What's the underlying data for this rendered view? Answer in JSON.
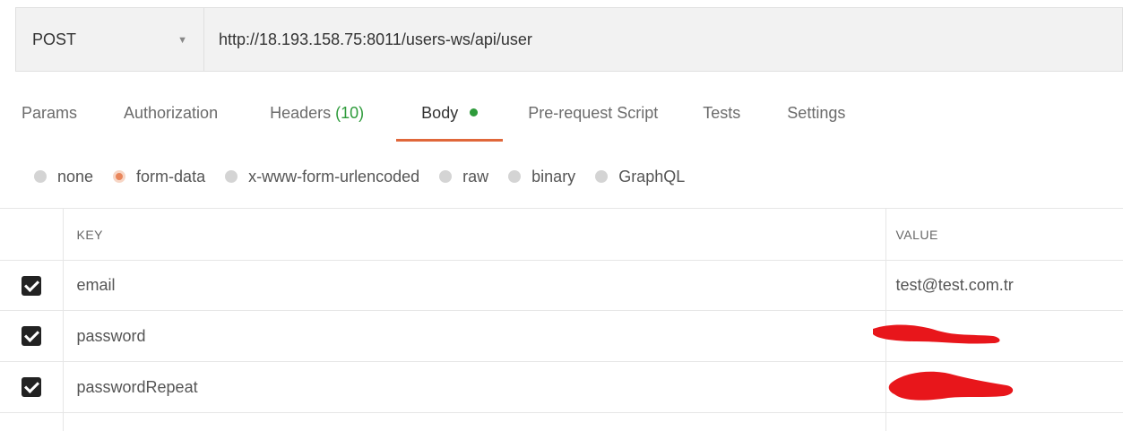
{
  "request": {
    "method": "POST",
    "url": "http://18.193.158.75:8011/users-ws/api/user"
  },
  "tabs": [
    {
      "label": "Params"
    },
    {
      "label": "Authorization"
    },
    {
      "label": "Headers",
      "count": "(10)"
    },
    {
      "label": "Body",
      "active": true,
      "indicator": "green-dot"
    },
    {
      "label": "Pre-request Script"
    },
    {
      "label": "Tests"
    },
    {
      "label": "Settings"
    }
  ],
  "body_modes": [
    {
      "label": "none",
      "selected": false
    },
    {
      "label": "form-data",
      "selected": true
    },
    {
      "label": "x-www-form-urlencoded",
      "selected": false
    },
    {
      "label": "raw",
      "selected": false
    },
    {
      "label": "binary",
      "selected": false
    },
    {
      "label": "GraphQL",
      "selected": false
    }
  ],
  "table": {
    "headers": {
      "key": "KEY",
      "value": "VALUE"
    },
    "rows": [
      {
        "checked": true,
        "key": "email",
        "value": "test@test.com.tr",
        "redacted": false
      },
      {
        "checked": true,
        "key": "password",
        "value": "",
        "redacted": true
      },
      {
        "checked": true,
        "key": "passwordRepeat",
        "value": "",
        "redacted": true
      }
    ]
  },
  "colors": {
    "accent_underline": "#e0673a",
    "status_green": "#2e9b3b",
    "radio_selected": "#e9865b",
    "redaction": "#e8161b"
  },
  "icons": {
    "method_caret": "chevron-down-icon",
    "checkbox": "checkbox-checked-icon"
  }
}
